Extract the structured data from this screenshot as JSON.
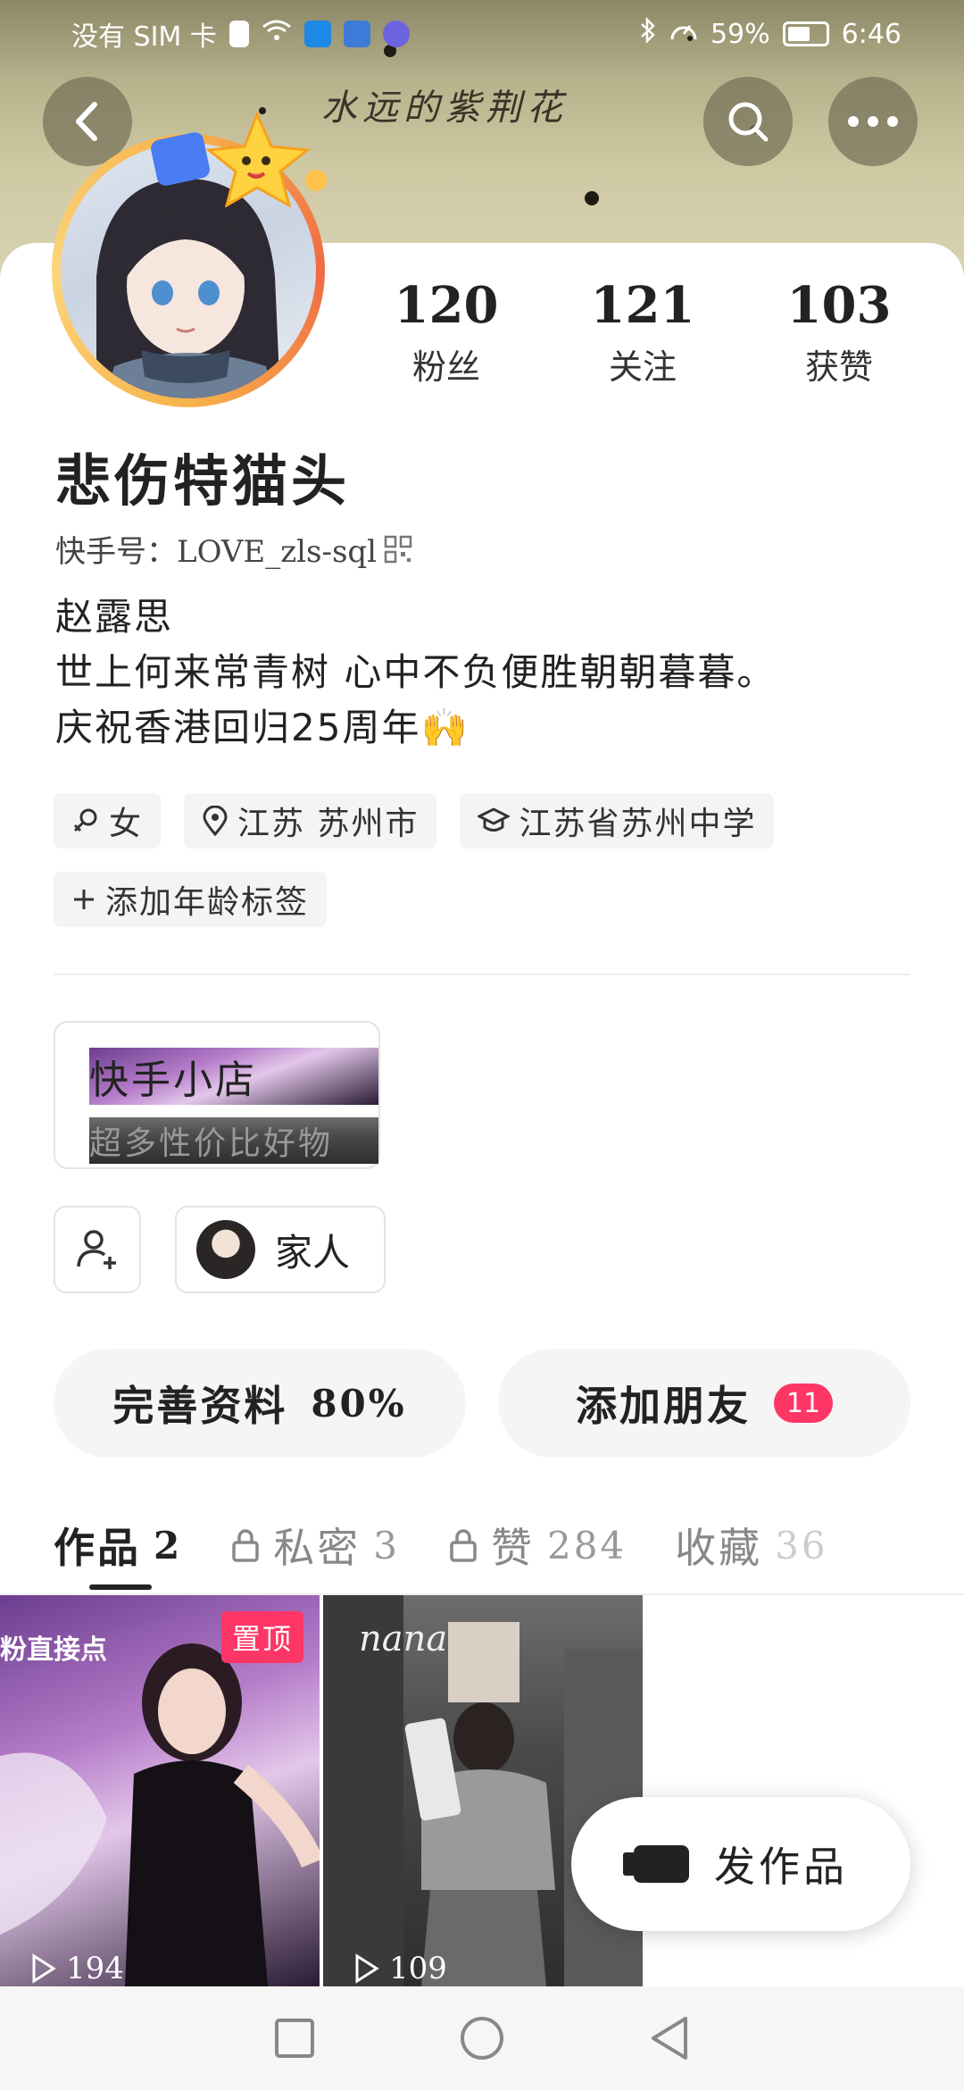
{
  "status_bar": {
    "carrier": "没有 SIM 卡",
    "battery": "59%",
    "time": "6:46"
  },
  "banner": {
    "text": "水远的紫荆花"
  },
  "header": {
    "back_icon": "back-arrow-icon",
    "search_icon": "search-icon",
    "more_icon": "more-dots-icon"
  },
  "stats": [
    {
      "value": "120",
      "label": "粉丝"
    },
    {
      "value": "121",
      "label": "关注"
    },
    {
      "value": "103",
      "label": "获赞"
    }
  ],
  "profile": {
    "name": "悲伤特猫头",
    "kuaishou_id": "快手号：LOVE_zls-sql",
    "bio": [
      "赵露思",
      "世上何来常青树 心中不负便胜朝朝暮暮。",
      "庆祝香港回归25周年🙌"
    ]
  },
  "tags": [
    {
      "icon": "gender-female-icon",
      "label": "女"
    },
    {
      "icon": "location-pin-icon",
      "label": "江苏 苏州市"
    },
    {
      "icon": "graduation-cap-icon",
      "label": "江苏省苏州中学"
    }
  ],
  "add_age_tag": "添加年龄标签",
  "shop": {
    "title": "快手小店",
    "subtitle": "超多性价比好物"
  },
  "family": {
    "label": "家人"
  },
  "actions": {
    "complete_profile": "完善资料",
    "complete_percent": "80%",
    "add_friends": "添加朋友",
    "add_friends_badge": "11"
  },
  "tabs": [
    {
      "label": "作品",
      "count": "2",
      "locked": false,
      "active": true
    },
    {
      "label": "私密",
      "count": "3",
      "locked": true,
      "active": false
    },
    {
      "label": "赞",
      "count": "284",
      "locked": true,
      "active": false
    },
    {
      "label": "收藏",
      "count": "36",
      "locked": false,
      "active": false
    }
  ],
  "videos": [
    {
      "plays": "194",
      "pinned_label": "置顶",
      "corner_text": "粉直接点"
    },
    {
      "plays": "109",
      "overlay_text": "nana"
    }
  ],
  "publish_button": "发作品",
  "colors": {
    "accent": "#fe3666",
    "text": "#222222",
    "muted": "#999999"
  }
}
